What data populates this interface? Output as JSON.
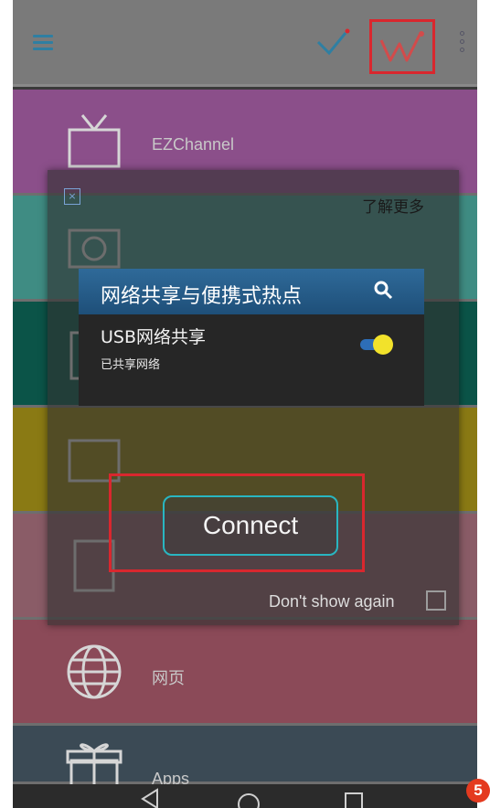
{
  "app_bar": {
    "menu_icon": "hamburger-icon",
    "check_icon": "checkmark-icon",
    "brand_icon": "w-logo-icon",
    "overflow_icon": "overflow-menu-icon",
    "accent_color": "#2f7fa2",
    "highlight_color": "#d9272e"
  },
  "channels": [
    {
      "label": "EZChannel",
      "icon": "tv-icon",
      "color": "#8b4f8a"
    },
    {
      "label": "",
      "icon": "photo-icon",
      "color": "#3f8c83"
    },
    {
      "label": "",
      "icon": "music-icon",
      "color": "#0b5448"
    },
    {
      "label": "",
      "icon": "video-icon",
      "color": "#8a7a14"
    },
    {
      "label": "",
      "icon": "document-icon",
      "color": "#8a5c67"
    },
    {
      "label": "网页",
      "icon": "globe-icon",
      "color": "#8b4a58"
    },
    {
      "label": "Apps",
      "icon": "gift-icon",
      "color": "#3b4a55"
    }
  ],
  "dialog": {
    "close_icon": "close-icon",
    "learn_more": "了解更多",
    "preview": {
      "title": "网络共享与便携式热点",
      "search_icon": "search-icon",
      "setting_title": "USB网络共享",
      "setting_subtitle": "已共享网络",
      "toggle_on": true
    },
    "connect_label": "Connect",
    "dont_show_label": "Don't show again",
    "dont_show_checked": false
  },
  "badge": "5"
}
